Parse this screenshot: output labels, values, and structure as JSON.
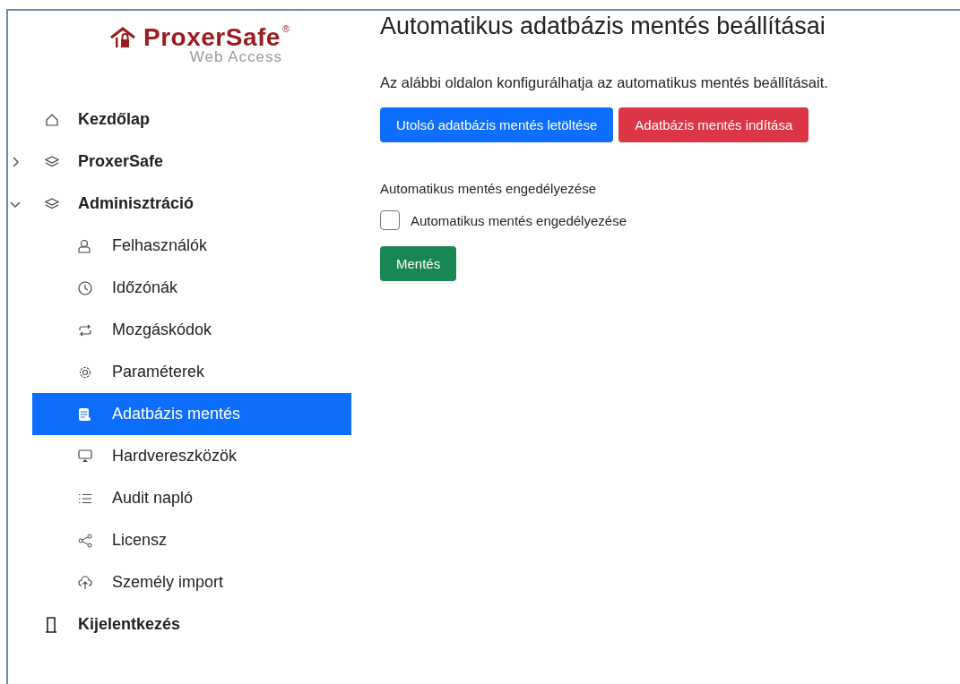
{
  "logo": {
    "name": "ProxerSafe",
    "registered": "®",
    "subtitle": "Web Access"
  },
  "sidebar": {
    "items": [
      {
        "label": "Kezdőlap"
      },
      {
        "label": "ProxerSafe",
        "expanded": false
      },
      {
        "label": "Adminisztráció",
        "expanded": true,
        "children": [
          {
            "label": "Felhasználók",
            "selected": false
          },
          {
            "label": "Időzónák",
            "selected": false
          },
          {
            "label": "Mozgáskódok",
            "selected": false
          },
          {
            "label": "Paraméterek",
            "selected": false
          },
          {
            "label": "Adatbázis mentés",
            "selected": true
          },
          {
            "label": "Hardvereszközök",
            "selected": false
          },
          {
            "label": "Audit napló",
            "selected": false
          },
          {
            "label": "Licensz",
            "selected": false
          },
          {
            "label": "Személy import",
            "selected": false
          }
        ]
      },
      {
        "label": "Kijelentkezés"
      }
    ]
  },
  "page": {
    "title": "Automatikus adatbázis mentés beállításai",
    "description": "Az alábbi oldalon konfigurálhatja az automatikus mentés beállításait.",
    "buttons": [
      {
        "label": "Utolsó adatbázis mentés letöltése",
        "kind": "primary"
      },
      {
        "label": "Adatbázis mentés indítása",
        "kind": "danger"
      }
    ],
    "section_label": "Automatikus mentés engedélyezése",
    "checkbox": {
      "label": "Automatikus mentés engedélyezése",
      "checked": false
    },
    "save_button": "Mentés"
  }
}
